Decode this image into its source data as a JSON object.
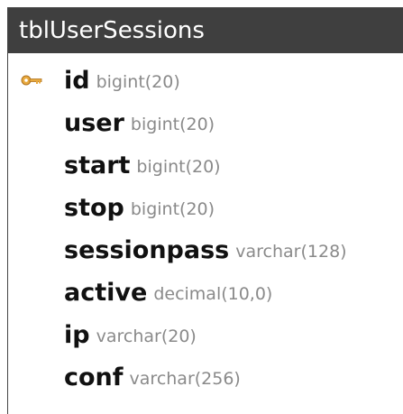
{
  "table": {
    "name": "tblUserSessions",
    "colors": {
      "header_bg": "#3f3f3f",
      "header_text": "#ffffff",
      "field_name": "#111111",
      "field_type": "#8a8a8a",
      "key_icon": "#e0a23a"
    },
    "fields": [
      {
        "name": "id",
        "type": "bigint(20)",
        "primary_key": true,
        "icon": "key-icon"
      },
      {
        "name": "user",
        "type": "bigint(20)",
        "primary_key": false
      },
      {
        "name": "start",
        "type": "bigint(20)",
        "primary_key": false
      },
      {
        "name": "stop",
        "type": "bigint(20)",
        "primary_key": false
      },
      {
        "name": "sessionpass",
        "type": "varchar(128)",
        "primary_key": false
      },
      {
        "name": "active",
        "type": "decimal(10,0)",
        "primary_key": false
      },
      {
        "name": "ip",
        "type": "varchar(20)",
        "primary_key": false
      },
      {
        "name": "conf",
        "type": "varchar(256)",
        "primary_key": false
      }
    ]
  }
}
